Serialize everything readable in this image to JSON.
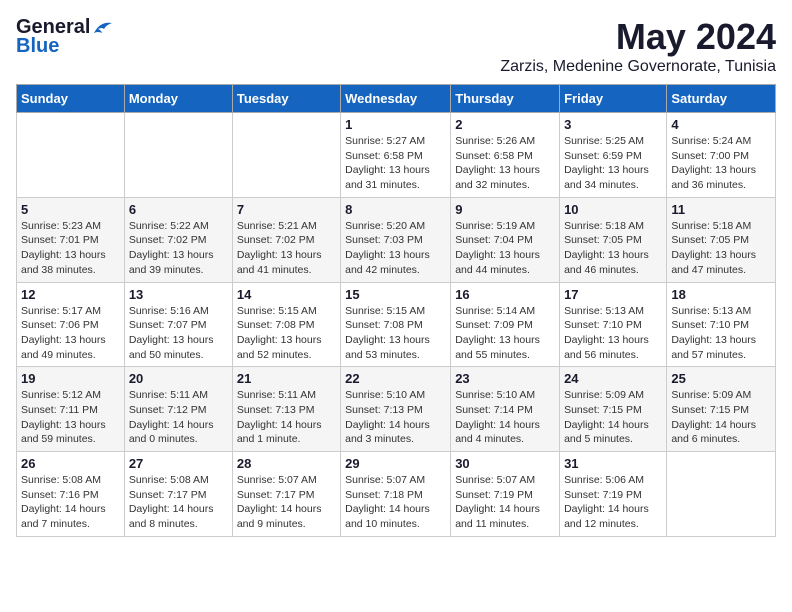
{
  "header": {
    "logo_general": "General",
    "logo_blue": "Blue",
    "month_title": "May 2024",
    "location": "Zarzis, Medenine Governorate, Tunisia"
  },
  "days_of_week": [
    "Sunday",
    "Monday",
    "Tuesday",
    "Wednesday",
    "Thursday",
    "Friday",
    "Saturday"
  ],
  "weeks": [
    [
      {
        "day": "",
        "info": ""
      },
      {
        "day": "",
        "info": ""
      },
      {
        "day": "",
        "info": ""
      },
      {
        "day": "1",
        "info": "Sunrise: 5:27 AM\nSunset: 6:58 PM\nDaylight: 13 hours\nand 31 minutes."
      },
      {
        "day": "2",
        "info": "Sunrise: 5:26 AM\nSunset: 6:58 PM\nDaylight: 13 hours\nand 32 minutes."
      },
      {
        "day": "3",
        "info": "Sunrise: 5:25 AM\nSunset: 6:59 PM\nDaylight: 13 hours\nand 34 minutes."
      },
      {
        "day": "4",
        "info": "Sunrise: 5:24 AM\nSunset: 7:00 PM\nDaylight: 13 hours\nand 36 minutes."
      }
    ],
    [
      {
        "day": "5",
        "info": "Sunrise: 5:23 AM\nSunset: 7:01 PM\nDaylight: 13 hours\nand 38 minutes."
      },
      {
        "day": "6",
        "info": "Sunrise: 5:22 AM\nSunset: 7:02 PM\nDaylight: 13 hours\nand 39 minutes."
      },
      {
        "day": "7",
        "info": "Sunrise: 5:21 AM\nSunset: 7:02 PM\nDaylight: 13 hours\nand 41 minutes."
      },
      {
        "day": "8",
        "info": "Sunrise: 5:20 AM\nSunset: 7:03 PM\nDaylight: 13 hours\nand 42 minutes."
      },
      {
        "day": "9",
        "info": "Sunrise: 5:19 AM\nSunset: 7:04 PM\nDaylight: 13 hours\nand 44 minutes."
      },
      {
        "day": "10",
        "info": "Sunrise: 5:18 AM\nSunset: 7:05 PM\nDaylight: 13 hours\nand 46 minutes."
      },
      {
        "day": "11",
        "info": "Sunrise: 5:18 AM\nSunset: 7:05 PM\nDaylight: 13 hours\nand 47 minutes."
      }
    ],
    [
      {
        "day": "12",
        "info": "Sunrise: 5:17 AM\nSunset: 7:06 PM\nDaylight: 13 hours\nand 49 minutes."
      },
      {
        "day": "13",
        "info": "Sunrise: 5:16 AM\nSunset: 7:07 PM\nDaylight: 13 hours\nand 50 minutes."
      },
      {
        "day": "14",
        "info": "Sunrise: 5:15 AM\nSunset: 7:08 PM\nDaylight: 13 hours\nand 52 minutes."
      },
      {
        "day": "15",
        "info": "Sunrise: 5:15 AM\nSunset: 7:08 PM\nDaylight: 13 hours\nand 53 minutes."
      },
      {
        "day": "16",
        "info": "Sunrise: 5:14 AM\nSunset: 7:09 PM\nDaylight: 13 hours\nand 55 minutes."
      },
      {
        "day": "17",
        "info": "Sunrise: 5:13 AM\nSunset: 7:10 PM\nDaylight: 13 hours\nand 56 minutes."
      },
      {
        "day": "18",
        "info": "Sunrise: 5:13 AM\nSunset: 7:10 PM\nDaylight: 13 hours\nand 57 minutes."
      }
    ],
    [
      {
        "day": "19",
        "info": "Sunrise: 5:12 AM\nSunset: 7:11 PM\nDaylight: 13 hours\nand 59 minutes."
      },
      {
        "day": "20",
        "info": "Sunrise: 5:11 AM\nSunset: 7:12 PM\nDaylight: 14 hours\nand 0 minutes."
      },
      {
        "day": "21",
        "info": "Sunrise: 5:11 AM\nSunset: 7:13 PM\nDaylight: 14 hours\nand 1 minute."
      },
      {
        "day": "22",
        "info": "Sunrise: 5:10 AM\nSunset: 7:13 PM\nDaylight: 14 hours\nand 3 minutes."
      },
      {
        "day": "23",
        "info": "Sunrise: 5:10 AM\nSunset: 7:14 PM\nDaylight: 14 hours\nand 4 minutes."
      },
      {
        "day": "24",
        "info": "Sunrise: 5:09 AM\nSunset: 7:15 PM\nDaylight: 14 hours\nand 5 minutes."
      },
      {
        "day": "25",
        "info": "Sunrise: 5:09 AM\nSunset: 7:15 PM\nDaylight: 14 hours\nand 6 minutes."
      }
    ],
    [
      {
        "day": "26",
        "info": "Sunrise: 5:08 AM\nSunset: 7:16 PM\nDaylight: 14 hours\nand 7 minutes."
      },
      {
        "day": "27",
        "info": "Sunrise: 5:08 AM\nSunset: 7:17 PM\nDaylight: 14 hours\nand 8 minutes."
      },
      {
        "day": "28",
        "info": "Sunrise: 5:07 AM\nSunset: 7:17 PM\nDaylight: 14 hours\nand 9 minutes."
      },
      {
        "day": "29",
        "info": "Sunrise: 5:07 AM\nSunset: 7:18 PM\nDaylight: 14 hours\nand 10 minutes."
      },
      {
        "day": "30",
        "info": "Sunrise: 5:07 AM\nSunset: 7:19 PM\nDaylight: 14 hours\nand 11 minutes."
      },
      {
        "day": "31",
        "info": "Sunrise: 5:06 AM\nSunset: 7:19 PM\nDaylight: 14 hours\nand 12 minutes."
      },
      {
        "day": "",
        "info": ""
      }
    ]
  ]
}
